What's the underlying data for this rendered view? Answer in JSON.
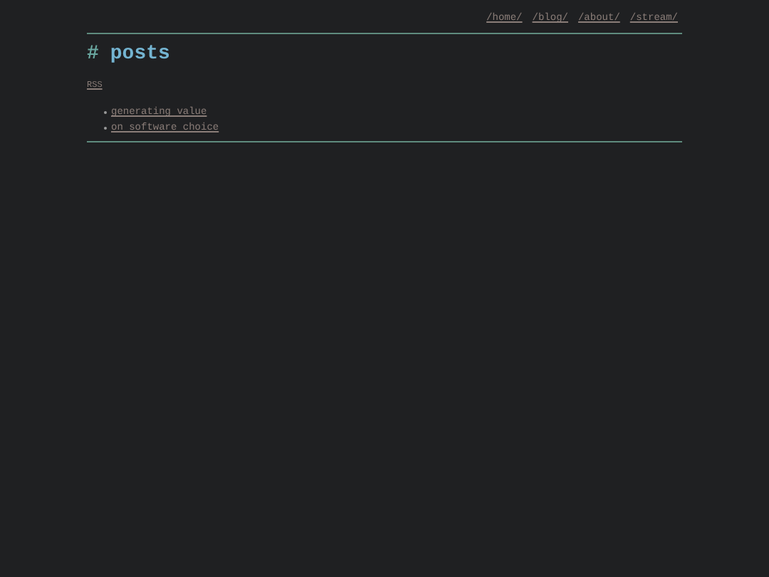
{
  "nav": [
    "/home/",
    "/blog/",
    "/about/",
    "/stream/"
  ],
  "heading": {
    "marker": "#",
    "title": "posts"
  },
  "rss_link": "RSS",
  "posts": [
    "generating value",
    "on software choice"
  ]
}
